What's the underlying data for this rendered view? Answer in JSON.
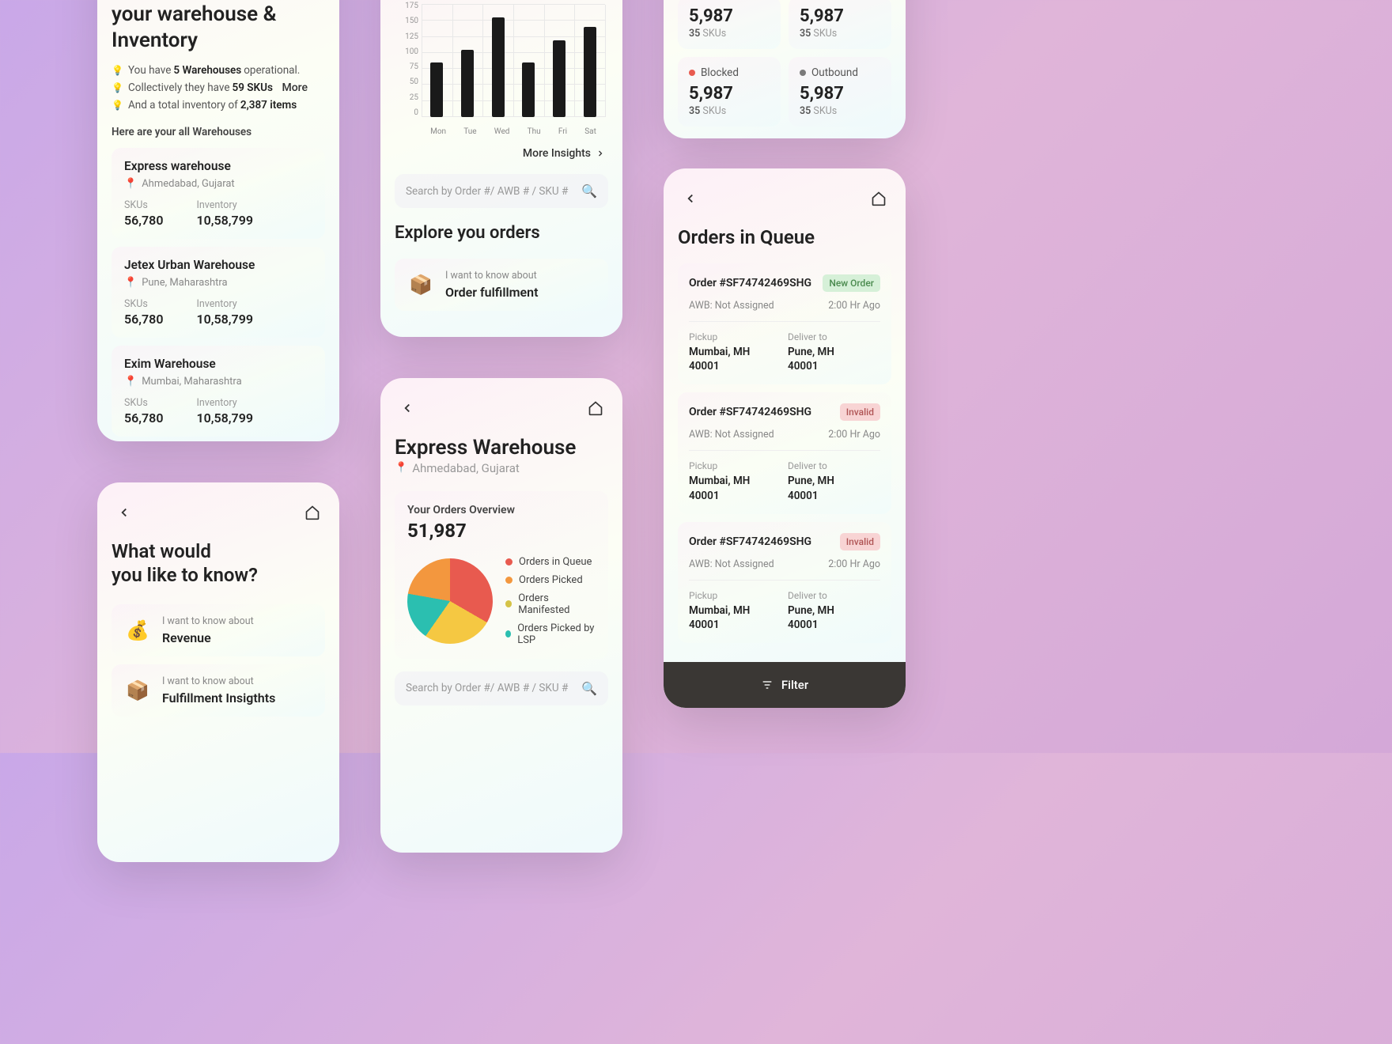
{
  "warehouse_screen": {
    "title": "your warehouse & Inventory",
    "bullets": {
      "b1_pre": "You have",
      "b1_bold": "5 Warehouses",
      "b1_post": "operational.",
      "b2_pre": "Collectively they have",
      "b2_bold": "59 SKUs",
      "b3_pre": "And a total inventory of",
      "b3_bold": "2,387 items"
    },
    "more": "More",
    "section_label": "Here are your all Warehouses",
    "items": [
      {
        "name": "Express warehouse",
        "location": "Ahmedabad, Gujarat",
        "skus_label": "SKUs",
        "skus": "56,780",
        "inv_label": "Inventory",
        "inv": "10,58,799"
      },
      {
        "name": "Jetex Urban Warehouse",
        "location": "Pune, Maharashtra",
        "skus_label": "SKUs",
        "skus": "56,780",
        "inv_label": "Inventory",
        "inv": "10,58,799"
      },
      {
        "name": "Exim Warehouse",
        "location": "Mumbai, Maharashtra",
        "skus_label": "SKUs",
        "skus": "56,780",
        "inv_label": "Inventory",
        "inv": "10,58,799"
      }
    ]
  },
  "insights_screen": {
    "title_l1": "What would",
    "title_l2": "you like to know?",
    "prompt": "I want to know about",
    "topics": [
      {
        "label": "Revenue",
        "icon": "💰"
      },
      {
        "label": "Fulfillment Insigthts",
        "icon": "📦"
      }
    ]
  },
  "chart_screen": {
    "more_insights": "More Insights",
    "search_placeholder": "Search by Order #/ AWB # / SKU #",
    "explore_title": "Explore you orders",
    "topic_prompt": "I want to know about",
    "topic_label": "Order fulfillment",
    "topic_icon": "📦"
  },
  "chart_data": {
    "type": "bar",
    "categories": [
      "Mon",
      "Tue",
      "Wed",
      "Thu",
      "Fri",
      "Sat"
    ],
    "values": [
      85,
      105,
      155,
      85,
      120,
      140
    ],
    "ylim": [
      0,
      175
    ],
    "yticks": [
      0,
      25,
      50,
      75,
      100,
      125,
      150,
      175
    ],
    "xlabel": "",
    "ylabel": ""
  },
  "express_screen": {
    "title": "Express Warehouse",
    "location": "Ahmedabad, Gujarat",
    "overview_label": "Your Orders Overview",
    "overview_value": "51,987",
    "legend": [
      {
        "label": "Orders in Queue",
        "color": "#e85a4f"
      },
      {
        "label": "Orders Picked",
        "color": "#f3973e"
      },
      {
        "label": "Orders Manifested",
        "color": "#d5c347"
      },
      {
        "label": "Orders Picked by LSP",
        "color": "#2bbfb0"
      }
    ],
    "search_placeholder": "Search by Order #/ AWB # / SKU #"
  },
  "kpi_screen": {
    "kpis": [
      {
        "label": "",
        "value": "5,987",
        "sub_n": "35",
        "sub_t": "SKUs",
        "color": ""
      },
      {
        "label": "",
        "value": "5,987",
        "sub_n": "35",
        "sub_t": "SKUs",
        "color": ""
      },
      {
        "label": "Blocked",
        "value": "5,987",
        "sub_n": "35",
        "sub_t": "SKUs",
        "color": "#e85a4f"
      },
      {
        "label": "Outbound",
        "value": "5,987",
        "sub_n": "35",
        "sub_t": "SKUs",
        "color": "#7a7a7a"
      }
    ]
  },
  "queue_screen": {
    "title": "Orders in Queue",
    "orders": [
      {
        "id": "Order #SF74742469SHG",
        "badge": "New Order",
        "badge_type": "new",
        "awb": "AWB: Not Assigned",
        "time": "2:00 Hr Ago",
        "pickup_lbl": "Pickup",
        "pickup": "Mumbai, MH",
        "pickup_pin": "40001",
        "deliver_lbl": "Deliver to",
        "deliver": "Pune, MH",
        "deliver_pin": "40001"
      },
      {
        "id": "Order #SF74742469SHG",
        "badge": "Invalid",
        "badge_type": "invalid",
        "awb": "AWB: Not Assigned",
        "time": "2:00 Hr Ago",
        "pickup_lbl": "Pickup",
        "pickup": "Mumbai, MH",
        "pickup_pin": "40001",
        "deliver_lbl": "Deliver to",
        "deliver": "Pune, MH",
        "deliver_pin": "40001"
      },
      {
        "id": "Order #SF74742469SHG",
        "badge": "Invalid",
        "badge_type": "invalid",
        "awb": "AWB: Not Assigned",
        "time": "2:00 Hr Ago",
        "pickup_lbl": "Pickup",
        "pickup": "Mumbai, MH",
        "pickup_pin": "40001",
        "deliver_lbl": "Deliver to",
        "deliver": "Pune, MH",
        "deliver_pin": "40001"
      }
    ],
    "filter": "Filter"
  }
}
